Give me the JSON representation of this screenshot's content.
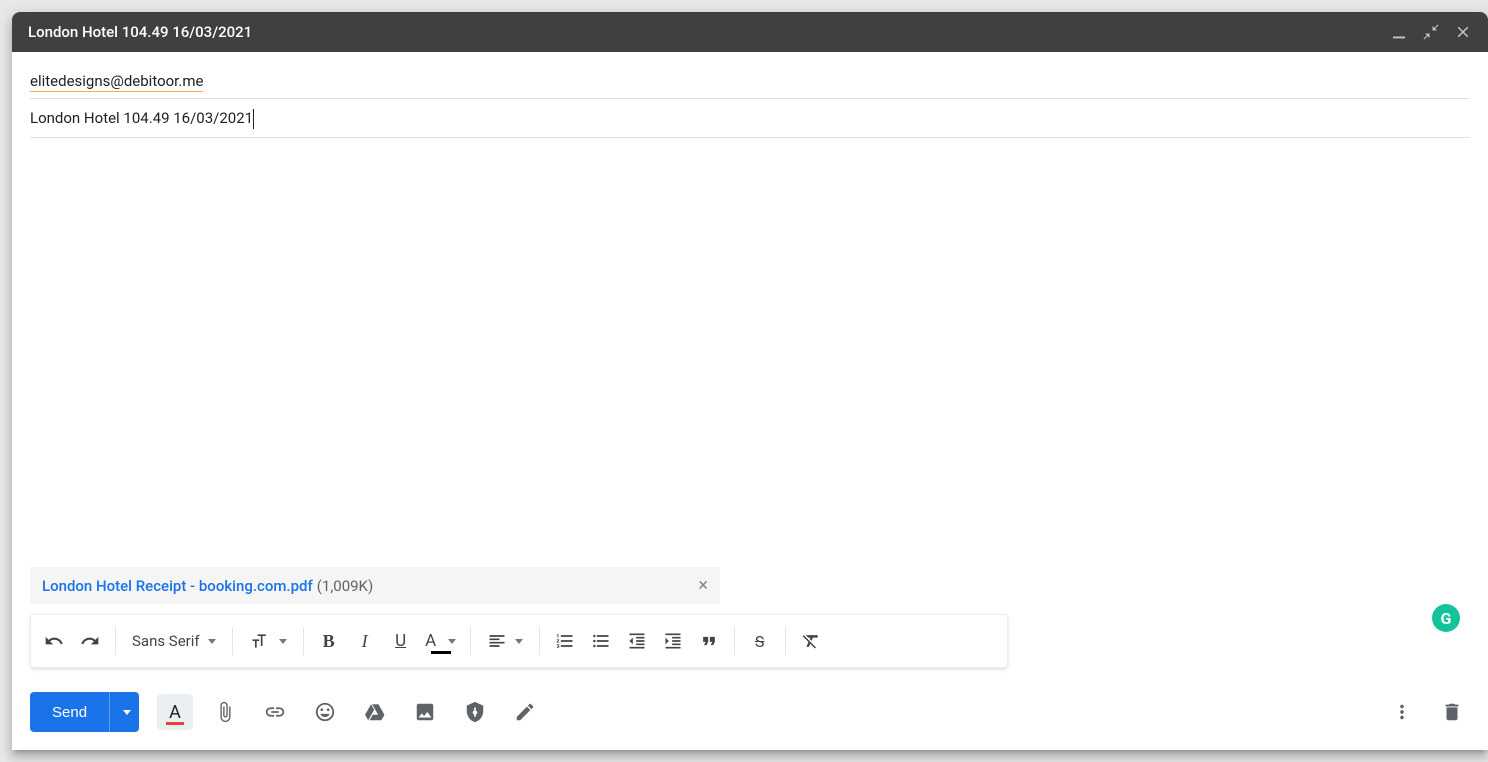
{
  "window": {
    "title": "London Hotel 104.49 16/03/2021"
  },
  "recipients": {
    "to": "elitedesigns@debitoor.me"
  },
  "subject": "London Hotel 104.49 16/03/2021",
  "attachment": {
    "name": "London Hotel Receipt - booking.com.pdf",
    "size": "(1,009K)"
  },
  "format_toolbar": {
    "font_family": "Sans Serif"
  },
  "actions": {
    "send_label": "Send"
  },
  "grammarly": {
    "badge": "G"
  }
}
